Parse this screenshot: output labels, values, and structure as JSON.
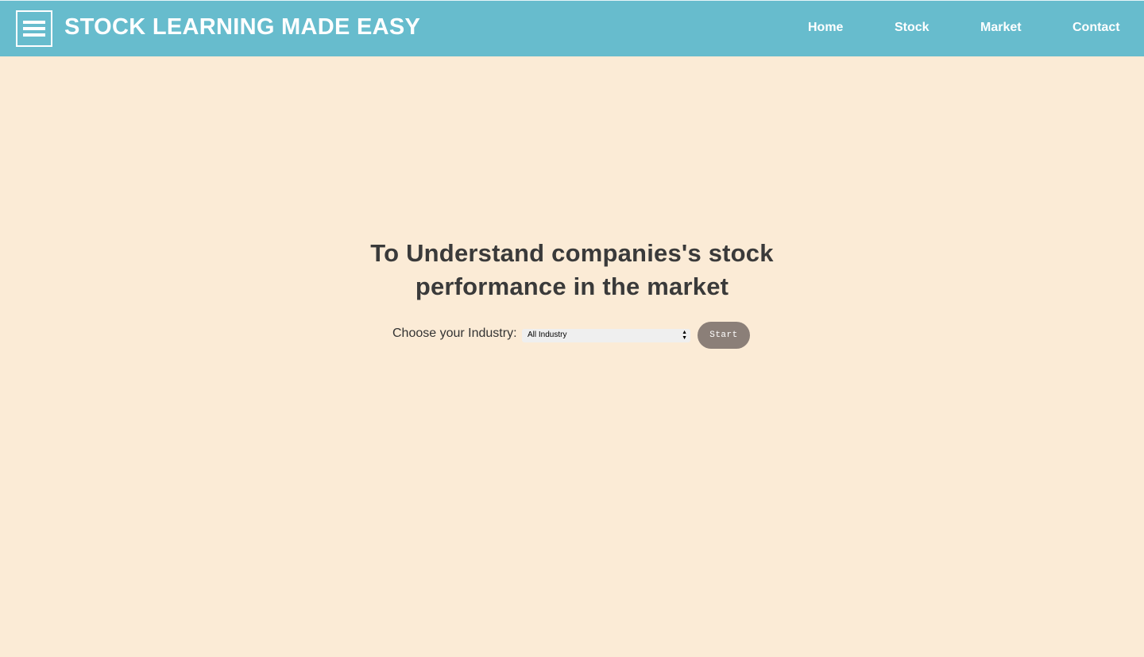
{
  "header": {
    "brand": "STOCK LEARNING MADE EASY",
    "menu_icon": "hamburger-menu-icon",
    "nav": [
      {
        "label": "Home"
      },
      {
        "label": "Stock"
      },
      {
        "label": "Market"
      },
      {
        "label": "Contact"
      }
    ]
  },
  "main": {
    "title_line1": "To Understand companies's stock",
    "title_line2": "performance in the market",
    "industry_label": "Choose your Industry:",
    "industry_selected": "All Industry",
    "start_label": "Start"
  },
  "colors": {
    "header_bg": "#67bccd",
    "page_bg": "#fbebd6",
    "title_text": "#3a3a3a",
    "button_bg": "#8b7f78"
  }
}
